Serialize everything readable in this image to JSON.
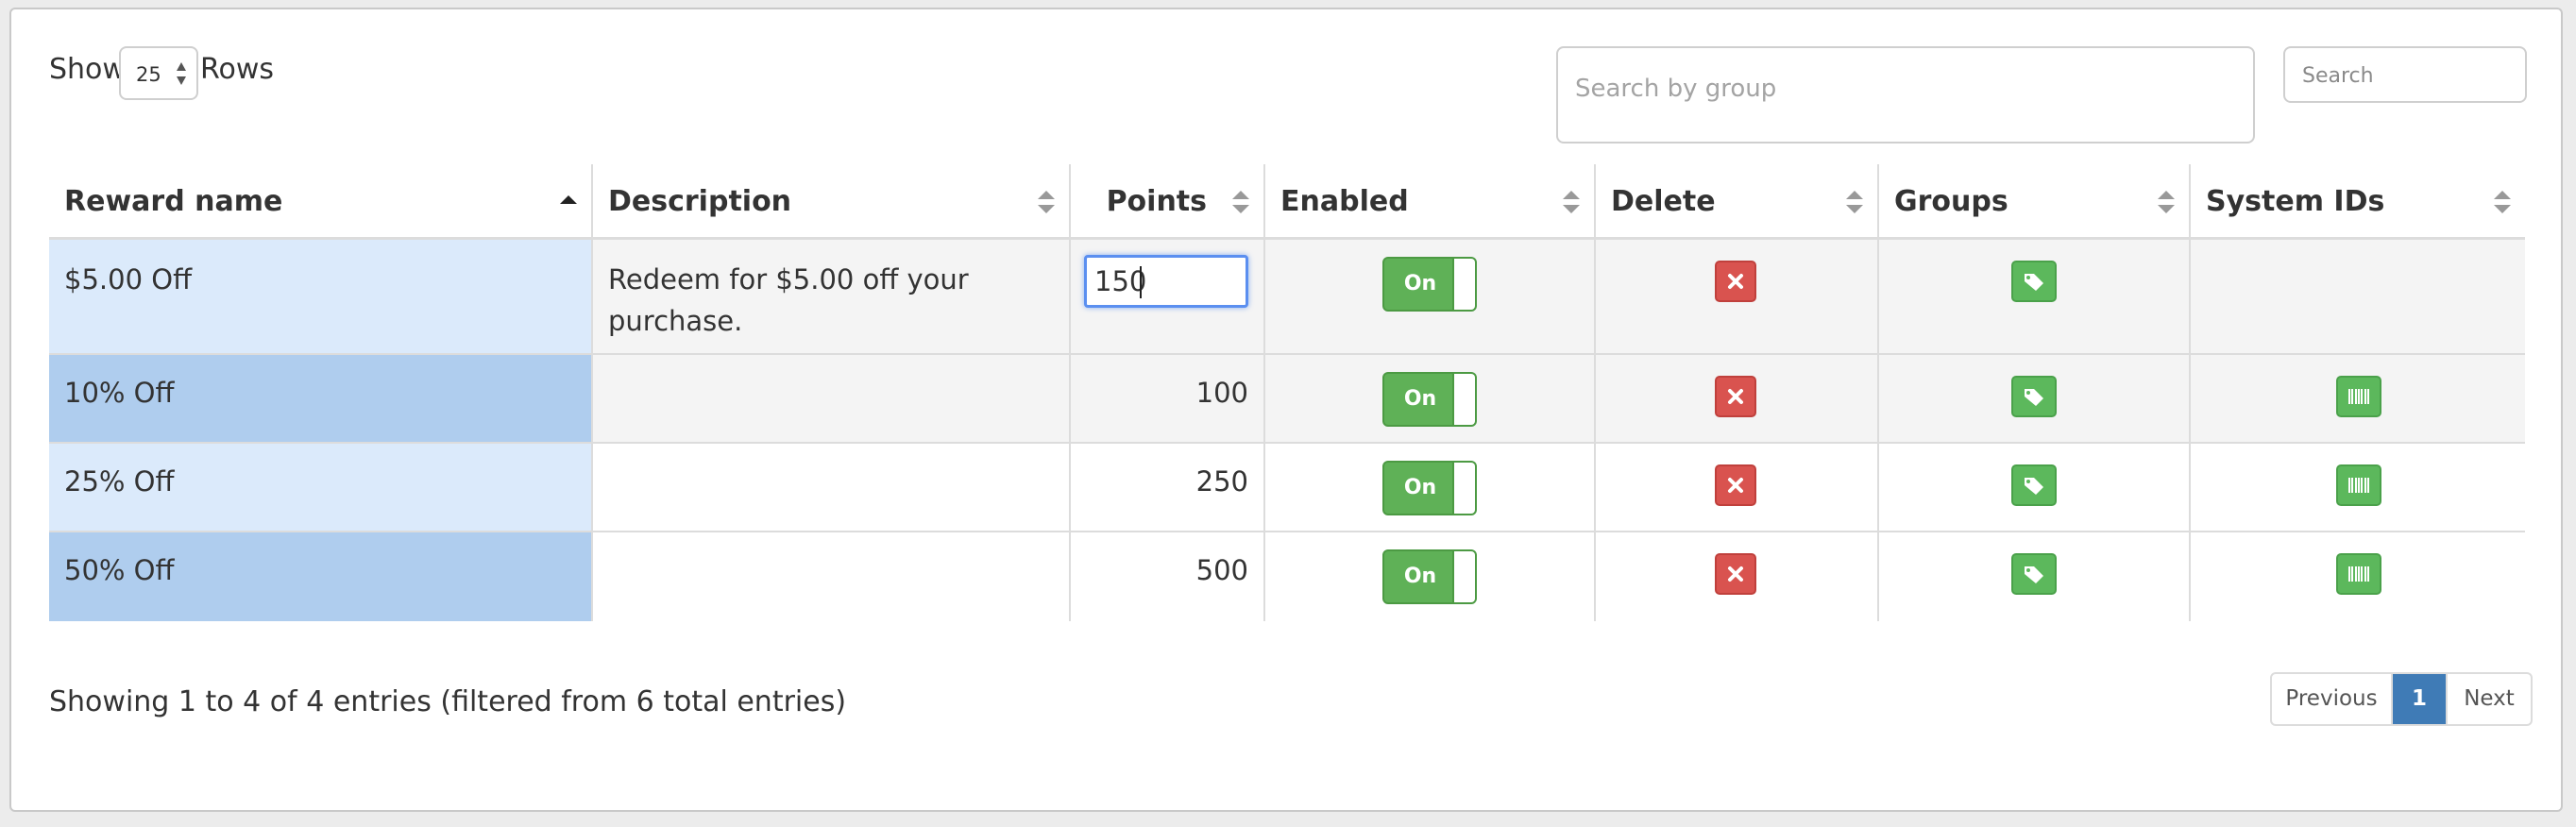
{
  "controls": {
    "show_label": "Show",
    "rows_value": "25",
    "rows_label": "Rows",
    "group_search_placeholder": "Search by group",
    "search_placeholder": "Search"
  },
  "table": {
    "headers": [
      "Reward name",
      "Description",
      "Points",
      "Enabled",
      "Delete",
      "Groups",
      "System IDs"
    ],
    "rows": [
      {
        "name": "$5.00 Off",
        "description": [
          "Redeem for $5.00 off your",
          "purchase."
        ],
        "points": "150",
        "enabled": "On",
        "has_system_id": false
      },
      {
        "name": "10% Off",
        "description": [],
        "points": "100",
        "enabled": "On",
        "has_system_id": true
      },
      {
        "name": "25% Off",
        "description": [],
        "points": "250",
        "enabled": "On",
        "has_system_id": true
      },
      {
        "name": "50% Off",
        "description": [],
        "points": "500",
        "enabled": "On",
        "has_system_id": true
      }
    ]
  },
  "footer": {
    "summary": "Showing 1 to 4 of 4 entries (filtered from 6 total entries)",
    "previous": "Previous",
    "current_page": "1",
    "next": "Next"
  },
  "icons": {
    "delete": "close-icon",
    "groups": "tag-icon",
    "system_ids": "barcode-icon",
    "sort_asc": "sort-asc-icon",
    "sort_both": "sort-icon"
  },
  "colors": {
    "toggle_on": "#5fb157",
    "delete_red": "#d9534f",
    "group_green": "#5cb85c",
    "page_active": "#3f7bb6",
    "row_select_light": "#dbeafb",
    "row_select_dark": "#afcdee"
  }
}
